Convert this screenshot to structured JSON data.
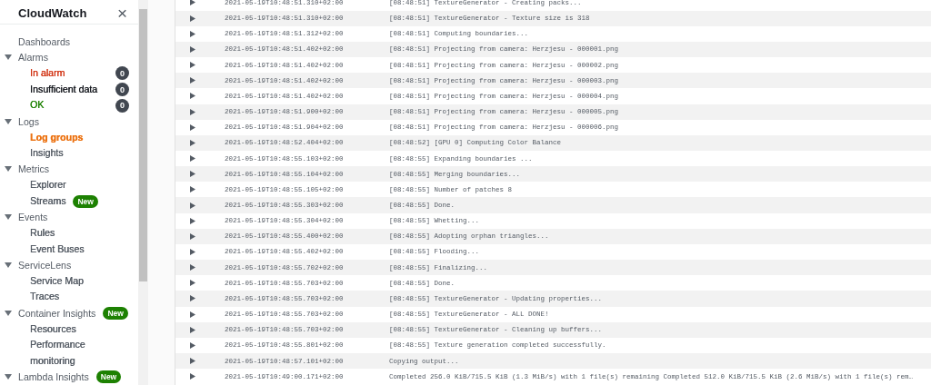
{
  "sidebar": {
    "title": "CloudWatch",
    "close": "×",
    "sections": [
      {
        "label": "Dashboards"
      },
      {
        "label": "Alarms",
        "expanded": true,
        "items": [
          {
            "label": "In alarm",
            "selected": false,
            "color": "#d13212",
            "count": "0"
          },
          {
            "label": "Insufficient data",
            "selected": false,
            "color": "#16191f",
            "count": "0"
          },
          {
            "label": "OK",
            "selected": false,
            "color": "#1d8102",
            "count": "0"
          }
        ]
      },
      {
        "label": "Logs",
        "expanded": true,
        "items": [
          {
            "label": "Log groups",
            "selected": true
          },
          {
            "label": "Insights",
            "selected": false
          }
        ]
      },
      {
        "label": "Metrics",
        "expanded": true,
        "items": [
          {
            "label": "Explorer",
            "selected": false
          },
          {
            "label": "Streams",
            "selected": false,
            "badge": "New"
          }
        ]
      },
      {
        "label": "Events",
        "expanded": true,
        "items": [
          {
            "label": "Rules",
            "selected": false
          },
          {
            "label": "Event Buses",
            "selected": false
          }
        ]
      },
      {
        "label": "ServiceLens",
        "expanded": true,
        "items": [
          {
            "label": "Service Map",
            "selected": false
          },
          {
            "label": "Traces",
            "selected": false
          }
        ]
      },
      {
        "label": "Container Insights",
        "badge": "New",
        "expanded": true,
        "items": [
          {
            "label": "Resources",
            "selected": false
          },
          {
            "label": "Performance monitoring",
            "selected": false
          }
        ]
      },
      {
        "label": "Lambda Insights",
        "badge": "New",
        "expanded": true
      }
    ]
  },
  "log_events": [
    {
      "timestamp": "2021-05-19T10:48:51.310+02:00",
      "message": "[08:48:51] TextureGenerator - Creating packs..."
    },
    {
      "timestamp": "2021-05-19T10:48:51.310+02:00",
      "message": "[08:48:51] TextureGenerator - Texture size is 318"
    },
    {
      "timestamp": "2021-05-19T10:48:51.312+02:00",
      "message": "[08:48:51] Computing boundaries..."
    },
    {
      "timestamp": "2021-05-19T10:48:51.402+02:00",
      "message": "[08:48:51] Projecting from camera: Herzjesu - 000001.png"
    },
    {
      "timestamp": "2021-05-19T10:48:51.402+02:00",
      "message": "[08:48:51] Projecting from camera: Herzjesu - 000002.png"
    },
    {
      "timestamp": "2021-05-19T10:48:51.402+02:00",
      "message": "[08:48:51] Projecting from camera: Herzjesu - 000003.png"
    },
    {
      "timestamp": "2021-05-19T10:48:51.402+02:00",
      "message": "[08:48:51] Projecting from camera: Herzjesu - 000004.png"
    },
    {
      "timestamp": "2021-05-19T10:48:51.900+02:00",
      "message": "[08:48:51] Projecting from camera: Herzjesu - 000005.png"
    },
    {
      "timestamp": "2021-05-19T10:48:51.904+02:00",
      "message": "[08:48:51] Projecting from camera: Herzjesu - 000006.png"
    },
    {
      "timestamp": "2021-05-19T10:48:52.404+02:00",
      "message": "[08:48:52] [GPU 0] Computing Color Balance"
    },
    {
      "timestamp": "2021-05-19T10:48:55.103+02:00",
      "message": "[08:48:55] Expanding boundaries ..."
    },
    {
      "timestamp": "2021-05-19T10:48:55.104+02:00",
      "message": "[08:48:55] Merging boundaries..."
    },
    {
      "timestamp": "2021-05-19T10:48:55.105+02:00",
      "message": "[08:48:55] Number of patches 8"
    },
    {
      "timestamp": "2021-05-19T10:48:55.303+02:00",
      "message": "[08:48:55] Done."
    },
    {
      "timestamp": "2021-05-19T10:48:55.304+02:00",
      "message": "[08:48:55] Whetting..."
    },
    {
      "timestamp": "2021-05-19T10:48:55.400+02:00",
      "message": "[08:48:55] Adopting orphan triangles..."
    },
    {
      "timestamp": "2021-05-19T10:48:55.402+02:00",
      "message": "[08:48:55] Flooding..."
    },
    {
      "timestamp": "2021-05-19T10:48:55.702+02:00",
      "message": "[08:48:55] Finalizing..."
    },
    {
      "timestamp": "2021-05-19T10:48:55.703+02:00",
      "message": "[08:48:55] Done."
    },
    {
      "timestamp": "2021-05-19T10:48:55.703+02:00",
      "message": "[08:48:55] TextureGenerator - Updating properties..."
    },
    {
      "timestamp": "2021-05-19T10:48:55.703+02:00",
      "message": "[08:48:55] TextureGenerator - ALL DONE!"
    },
    {
      "timestamp": "2021-05-19T10:48:55.703+02:00",
      "message": "[08:48:55] TextureGenerator - Cleaning up buffers..."
    },
    {
      "timestamp": "2021-05-19T10:48:55.801+02:00",
      "message": "[08:48:55] Texture generation completed successfully."
    },
    {
      "timestamp": "2021-05-19T10:48:57.101+02:00",
      "message": "Copying output..."
    },
    {
      "timestamp": "2021-05-19T10:49:00.171+02:00",
      "message": "Completed 256.0 KiB/715.5 KiB (1.3 MiB/s) with 1 file(s) remaining Completed 512.0 KiB/715.5 KiB (2.6 MiB/s) with 1 file(s) rem…"
    }
  ]
}
